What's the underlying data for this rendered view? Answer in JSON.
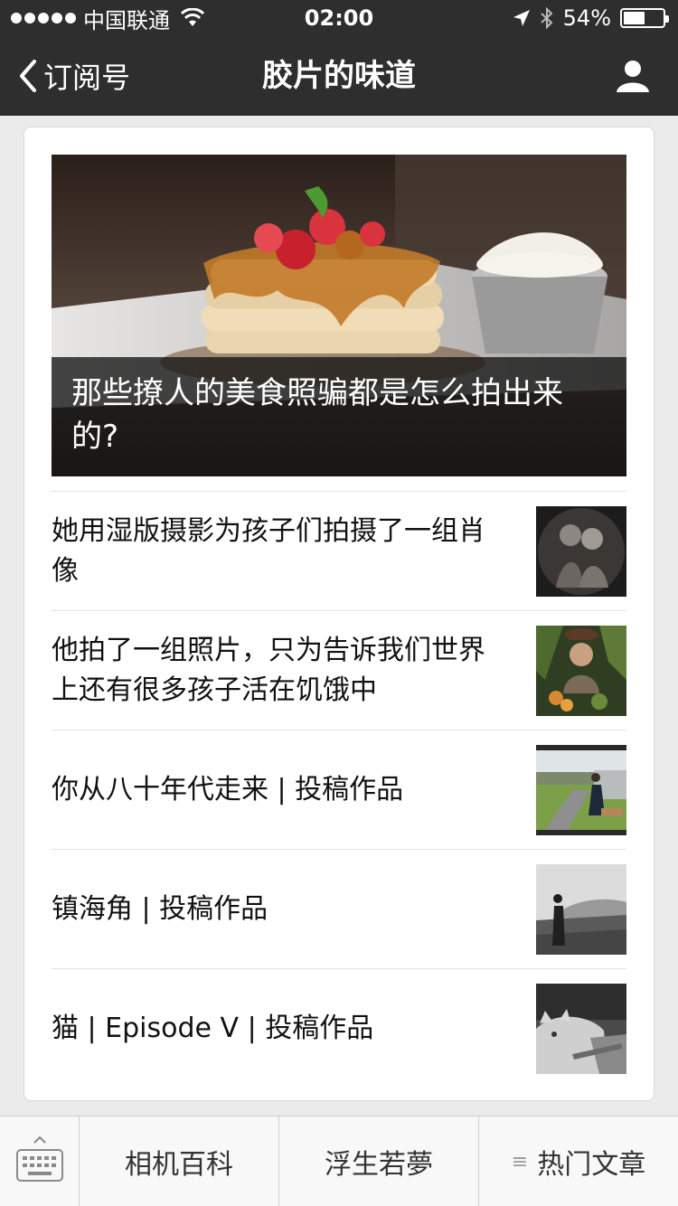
{
  "status_bar": {
    "carrier": "中国联通",
    "time": "02:00",
    "battery": "54%",
    "battery_level": 0.54
  },
  "nav": {
    "back_label": "订阅号",
    "title": "胶片的味道"
  },
  "hero": {
    "title": "那些撩人的美食照骗都是怎么拍出来的?"
  },
  "articles": [
    {
      "title": "她用湿版摄影为孩子们拍摄了一组肖像"
    },
    {
      "title": "他拍了一组照片，只为告诉我们世界上还有很多孩子活在饥饿中"
    },
    {
      "title": "你从八十年代走来 | 投稿作品"
    },
    {
      "title": "镇海角 | 投稿作品"
    },
    {
      "title": "猫 | Episode V | 投稿作品"
    }
  ],
  "bottom_menu": [
    {
      "label": "相机百科"
    },
    {
      "label": "浮生若夢"
    },
    {
      "label": "热门文章"
    }
  ]
}
